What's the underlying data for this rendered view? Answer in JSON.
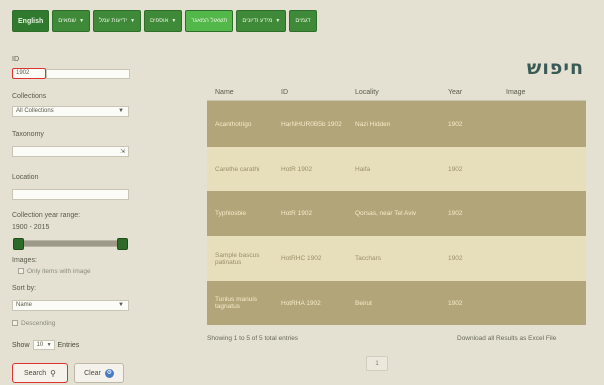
{
  "nav": {
    "items": [
      {
        "label": "English",
        "has_chevron": false
      },
      {
        "label": "שמאים",
        "has_chevron": true
      },
      {
        "label": "ידיעות עמל",
        "has_chevron": true
      },
      {
        "label": "אוספים",
        "has_chevron": true
      },
      {
        "label": "תשאול המאגר",
        "has_chevron": false
      },
      {
        "label": "מידע ודיונים",
        "has_chevron": true
      },
      {
        "label": "דגמים",
        "has_chevron": false
      }
    ],
    "active_index": 4,
    "colors": {
      "nav": "#3f8a38",
      "active": "#52b84a"
    }
  },
  "sidebar": {
    "id_label": "ID",
    "id_value": "1902",
    "collection_label": "Collections",
    "collection_value": "All Collections",
    "taxonomy_label": "Taxonomy",
    "taxonomy_value": "",
    "location_label": "Location",
    "location_value": "",
    "year_range_label": "Collection year range:",
    "year_range_value": "1900 - 2015",
    "images_label": "Images:",
    "images_checkbox": "Only items with image",
    "sort_label": "Sort by:",
    "sort_value": "Name",
    "descending_label": "Descending",
    "show_label": "Show",
    "show_value": "10",
    "entries_label": "Entries",
    "search_button": "Search",
    "clear_button": "Clear"
  },
  "main": {
    "title": "חיפוש",
    "columns": [
      "Name",
      "ID",
      "Locality",
      "Year",
      "Image"
    ],
    "rows": [
      {
        "name": "Acanthotrigo",
        "id": "HarNHUR0B5b 1902",
        "locality": "Nazi Hidden",
        "year": "1902",
        "image": ""
      },
      {
        "name": "Carethe carathi",
        "id": "HotR 1902",
        "locality": "Haifa",
        "year": "1902",
        "image": ""
      },
      {
        "name": "Typhlosbie",
        "id": "HotR 1902",
        "locality": "Qorsas, near Tel Aviv",
        "year": "1902",
        "image": ""
      },
      {
        "name": "Sample bascus patinatus",
        "id": "HotRHC 1902",
        "locality": "Tacchars",
        "year": "1902",
        "image": ""
      },
      {
        "name": "Tunlus manuis tagnatus",
        "id": "HotRHA 1902",
        "locality": "Beirut",
        "year": "1902",
        "image": ""
      }
    ],
    "summary": "Showing 1 to 5 of 5 total entries",
    "download": "Download all Results as Excel File",
    "page": "1"
  }
}
